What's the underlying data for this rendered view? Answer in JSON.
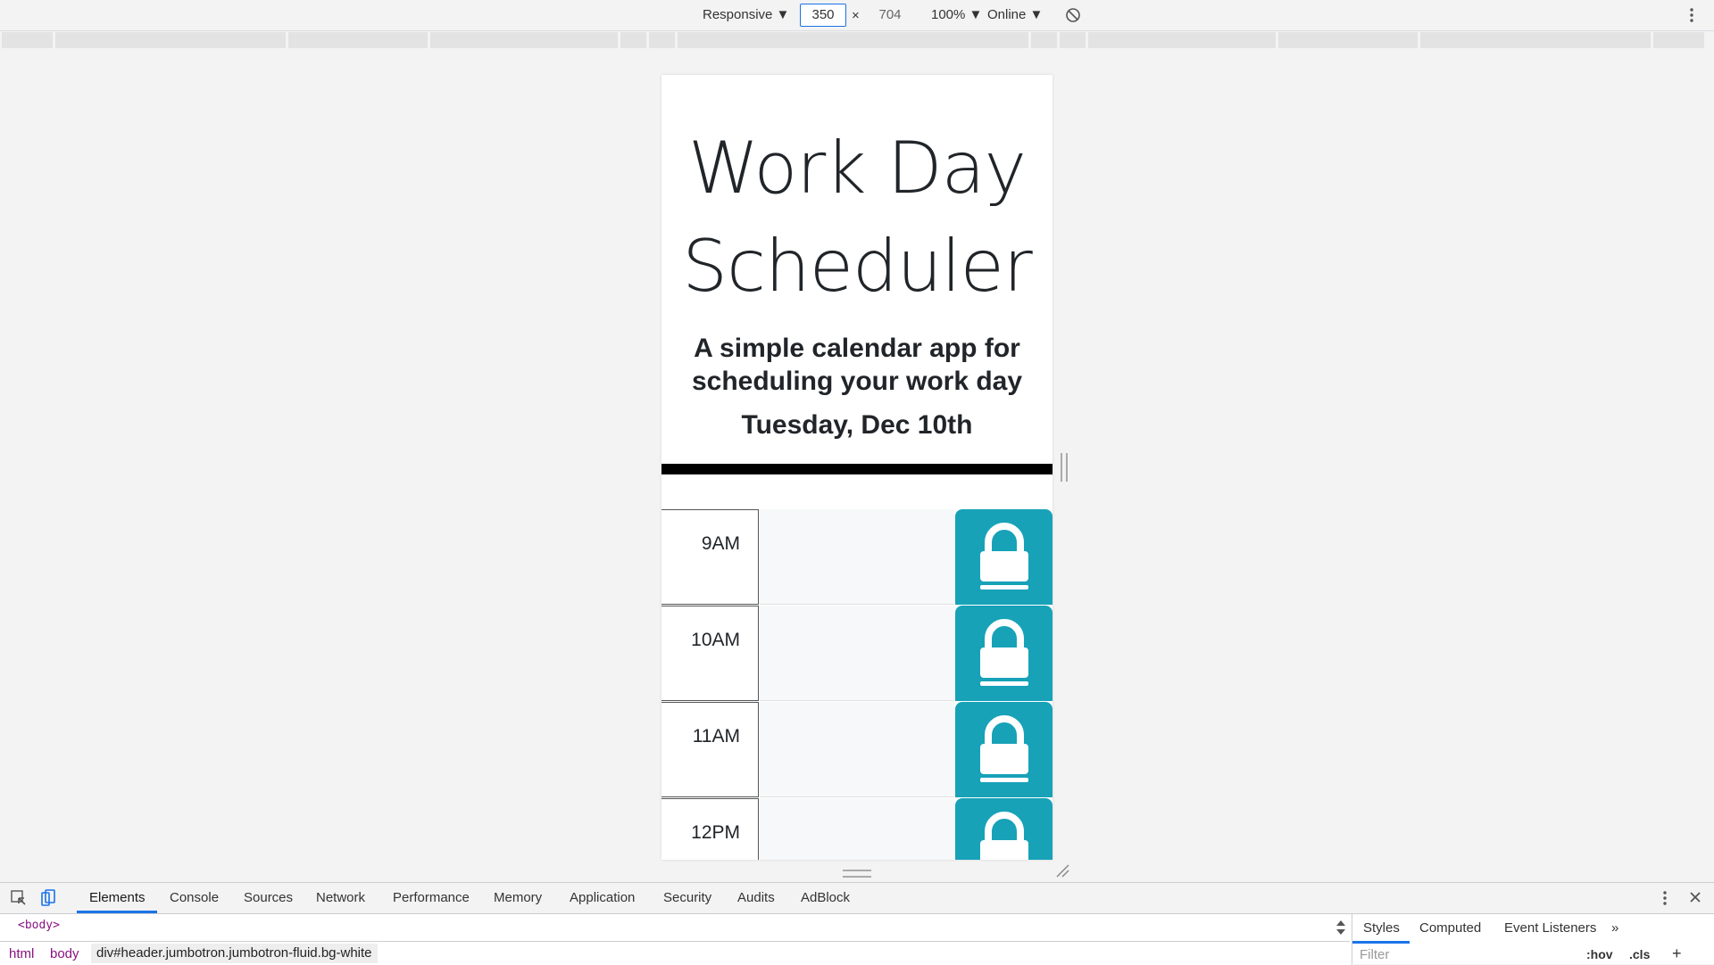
{
  "device_toolbar": {
    "device": "Responsive ▼",
    "width": "350",
    "times": "×",
    "height": "704",
    "zoom": "100% ▼",
    "network": "Online ▼"
  },
  "page": {
    "title": "Work Day Scheduler",
    "lead": "A simple calendar app for scheduling your work day",
    "date": "Tuesday, Dec 10th",
    "hours": [
      {
        "label": "9AM"
      },
      {
        "label": "10AM"
      },
      {
        "label": "11AM"
      },
      {
        "label": "12PM"
      }
    ]
  },
  "devtools": {
    "tabs": [
      "Elements",
      "Console",
      "Sources",
      "Network",
      "Performance",
      "Memory",
      "Application",
      "Security",
      "Audits",
      "AdBlock"
    ],
    "dom_line": "<body>",
    "breadcrumbs": [
      "html",
      "body",
      "div#header.jumbotron.jumbotron-fluid.bg-white"
    ],
    "styles_tabs": [
      "Styles",
      "Computed",
      "Event Listeners"
    ],
    "styles_more": "»",
    "filter_placeholder": "Filter",
    "hov": ":hov",
    "cls": ".cls",
    "add": "+"
  },
  "colors": {
    "save_button": "#17a2b8",
    "text": "#212529",
    "accent": "#1a73e8"
  }
}
